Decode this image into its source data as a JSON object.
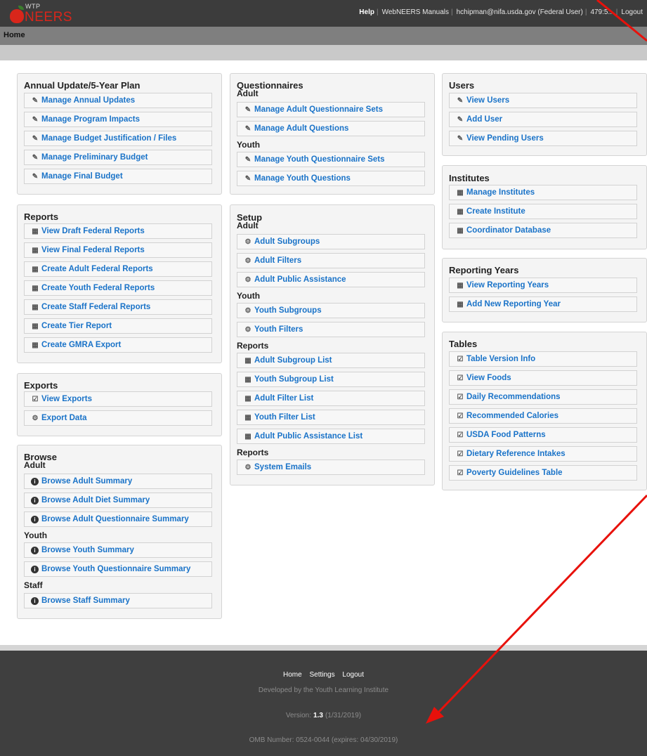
{
  "header": {
    "logo_small": "WTP",
    "logo_brand": "NEERS",
    "help": "Help",
    "manuals": "WebNEERS Manuals",
    "user": "hchipman@nifa.usda.gov (Federal User)",
    "id": "479:5...",
    "logout": "Logout"
  },
  "breadcrumb": {
    "home": "Home"
  },
  "col1": {
    "annual": {
      "title": "Annual Update/5-Year Plan",
      "items": [
        "Manage Annual Updates",
        "Manage Program Impacts",
        "Manage Budget Justification / Files",
        "Manage Preliminary Budget",
        "Manage Final Budget"
      ]
    },
    "reports": {
      "title": "Reports",
      "items": [
        "View Draft Federal Reports",
        "View Final Federal Reports",
        "Create Adult Federal Reports",
        "Create Youth Federal Reports",
        "Create Staff Federal Reports",
        "Create Tier Report",
        "Create GMRA Export"
      ]
    },
    "exports": {
      "title": "Exports",
      "items": [
        "View Exports",
        "Export Data"
      ]
    },
    "browse": {
      "title": "Browse",
      "adult_label": "Adult",
      "adult_items": [
        "Browse Adult Summary",
        "Browse Adult Diet Summary",
        "Browse Adult Questionnaire Summary"
      ],
      "youth_label": "Youth",
      "youth_items": [
        "Browse Youth Summary",
        "Browse Youth Questionnaire Summary"
      ],
      "staff_label": "Staff",
      "staff_items": [
        "Browse Staff Summary"
      ]
    }
  },
  "col2": {
    "questionnaires": {
      "title": "Questionnaires",
      "adult_label": "Adult",
      "adult_items": [
        "Manage Adult Questionnaire Sets",
        "Manage Adult Questions"
      ],
      "youth_label": "Youth",
      "youth_items": [
        "Manage Youth Questionnaire Sets",
        "Manage Youth Questions"
      ]
    },
    "setup": {
      "title": "Setup",
      "adult_label": "Adult",
      "adult_items": [
        "Adult Subgroups",
        "Adult Filters",
        "Adult Public Assistance"
      ],
      "youth_label": "Youth",
      "youth_items": [
        "Youth Subgroups",
        "Youth Filters"
      ],
      "reports_label": "Reports",
      "reports_items": [
        "Adult Subgroup List",
        "Youth Subgroup List",
        "Adult Filter List",
        "Youth Filter List",
        "Adult Public Assistance List"
      ],
      "reports2_label": "Reports",
      "reports2_items": [
        "System Emails"
      ]
    }
  },
  "col3": {
    "users": {
      "title": "Users",
      "items": [
        "View Users",
        "Add User",
        "View Pending Users"
      ]
    },
    "institutes": {
      "title": "Institutes",
      "items": [
        "Manage Institutes",
        "Create Institute",
        "Coordinator Database"
      ]
    },
    "years": {
      "title": "Reporting Years",
      "items": [
        "View Reporting Years",
        "Add New Reporting Year"
      ]
    },
    "tables": {
      "title": "Tables",
      "items": [
        "Table Version Info",
        "View Foods",
        "Daily Recommendations",
        "Recommended Calories",
        "USDA Food Patterns",
        "Dietary Reference Intakes",
        "Poverty Guidelines Table"
      ]
    }
  },
  "footer": {
    "home": "Home",
    "settings": "Settings",
    "logout": "Logout",
    "developed": "Developed by the Youth Learning Institute",
    "version_label": "Version:",
    "version": "1.3",
    "version_date": "(1/31/2019)",
    "omb": "OMB Number: 0524-0044 (expires: 04/30/2019)"
  },
  "colors": {
    "link": "#1a73c8",
    "header_bg": "#3c3c3c",
    "brand_red": "#d8261b",
    "arrow": "#e8110b"
  }
}
